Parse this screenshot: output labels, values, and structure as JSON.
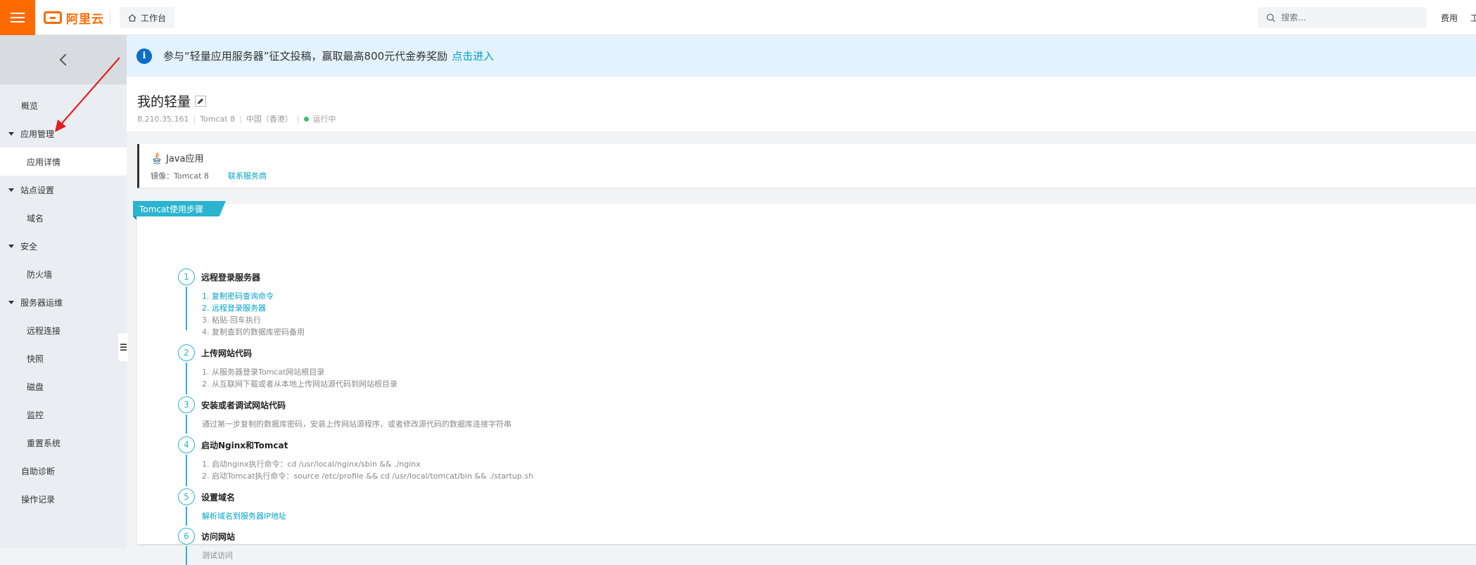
{
  "topbar": {
    "logo_text": "阿里云",
    "workbench_label": "工作台",
    "search_placeholder": "搜索...",
    "fee_label": "费用",
    "cut_label": "工"
  },
  "sidebar": {
    "items": [
      {
        "label": "概览"
      },
      {
        "label": "应用管理"
      },
      {
        "label": "应用详情"
      },
      {
        "label": "站点设置"
      },
      {
        "label": "域名"
      },
      {
        "label": "安全"
      },
      {
        "label": "防火墙"
      },
      {
        "label": "服务器运维"
      },
      {
        "label": "远程连接"
      },
      {
        "label": "快照"
      },
      {
        "label": "磁盘"
      },
      {
        "label": "监控"
      },
      {
        "label": "重置系统"
      },
      {
        "label": "自助诊断"
      },
      {
        "label": "操作记录"
      }
    ]
  },
  "notice": {
    "text": "参与“轻量应用服务器”征文投稿，赢取最高800元代金券奖励",
    "link": "点击进入"
  },
  "server": {
    "title": "我的轻量",
    "ip": "8.210.35.161",
    "image": "Tomcat 8",
    "region": "中国（香港）",
    "status": "运行中",
    "status_color": "#3dbf6a"
  },
  "app": {
    "name": "Java应用",
    "mirror": "镜像：Tomcat 8",
    "contact": "联系服务商"
  },
  "steps": {
    "badge": "Tomcat使用步骤",
    "items": [
      {
        "num": "1",
        "title": "远程登录服务器",
        "lines": [
          "1. 复制密码查询命令",
          "2. 远程登录服务器",
          "3. 粘贴-回车执行",
          "4. 复制查到的数据库密码备用"
        ]
      },
      {
        "num": "2",
        "title": "上传网站代码",
        "lines": [
          "1. 从服务器登录Tomcat网站根目录",
          "2. 从互联网下载或者从本地上传网站源代码到网站根目录"
        ]
      },
      {
        "num": "3",
        "title": "安装或者调试网站代码",
        "lines": [
          "通过第一步复制的数据库密码，安装上传网站源程序，或者修改源代码的数据库连接字符串"
        ]
      },
      {
        "num": "4",
        "title": "启动Nginx和Tomcat",
        "lines": [
          "1. 启动nginx执行命令：cd /usr/local/nginx/sbin && ./nginx",
          "2. 启动Tomcat执行命令：source /etc/profile && cd /usr/local/tomcat/bin && ./startup.sh"
        ]
      },
      {
        "num": "5",
        "title": "设置域名",
        "lines": [
          "解析域名到服务器IP地址"
        ]
      },
      {
        "num": "6",
        "title": "访问网站",
        "lines": [
          "测试访问"
        ]
      }
    ]
  },
  "colors": {
    "accent": "#ff6a00",
    "link": "#00a2ca",
    "step": "#2bb4cf",
    "annotation_arrow": "#e02020"
  }
}
